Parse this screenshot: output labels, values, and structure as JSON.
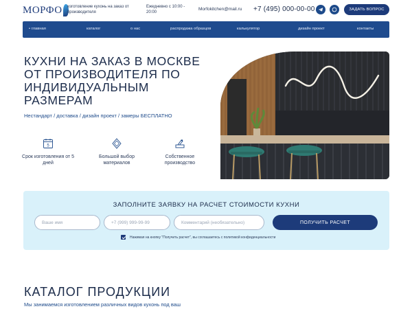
{
  "header": {
    "logo_text": "МОРФО",
    "tagline": "изготовление кухонь на заказ от производителя",
    "hours": "Ежедневно с 10:00 - 20:00",
    "email": "Morfokitchen@mail.ru",
    "phone": "+7 (495) 000-00-00",
    "ask_button": "ЗАДАТЬ ВОПРОС"
  },
  "nav": {
    "items": [
      {
        "label": "• главная"
      },
      {
        "label": "каталог"
      },
      {
        "label": "о нас"
      },
      {
        "label": "распродажа образцов"
      },
      {
        "label": "калькулятор"
      },
      {
        "label": "дизайн проект"
      },
      {
        "label": "контакты"
      }
    ]
  },
  "hero": {
    "title": "КУХНИ НА ЗАКАЗ В МОСКВЕ ОТ ПРОИЗВОДИТЕЛЯ ПО ИНДИВИДУАЛЬНЫМ РАЗМЕРАМ",
    "links": "Нестандарт  /  доставка  /  дизайн проект  /  замеры   БЕСПЛАТНО",
    "features": [
      {
        "text": "Срок изготовления от 5 дней",
        "icon": "calendar-icon"
      },
      {
        "text": "Большой выбор материалов",
        "icon": "diamond-icon"
      },
      {
        "text": "Собственное производство",
        "icon": "production-icon"
      }
    ],
    "calendar_digit": "5"
  },
  "form": {
    "title": "ЗАПОЛНИТЕ ЗАЯВКУ НА РАСЧЕТ СТОИМОСТИ КУХНИ",
    "name_placeholder": "Ваше имя",
    "phone_placeholder": "+7 (999) 999-99-99",
    "comment_placeholder": "Комментарий (необязательно)",
    "submit": "ПОЛУЧИТЬ РАСЧЕТ",
    "consent": "Нажимая на кнопку \"Получить расчет\", вы соглашаетесь с политикой конфиденциальности"
  },
  "catalog": {
    "title": "КАТАЛОГ ПРОДУКЦИИ",
    "subtitle": "Мы занимаемся изготовлением различных видов кухонь под ваш"
  },
  "colors": {
    "primary": "#1d3b7a",
    "nav": "#1f4b8e",
    "form_bg": "#d9f1fa",
    "link": "#1d4a8a"
  }
}
